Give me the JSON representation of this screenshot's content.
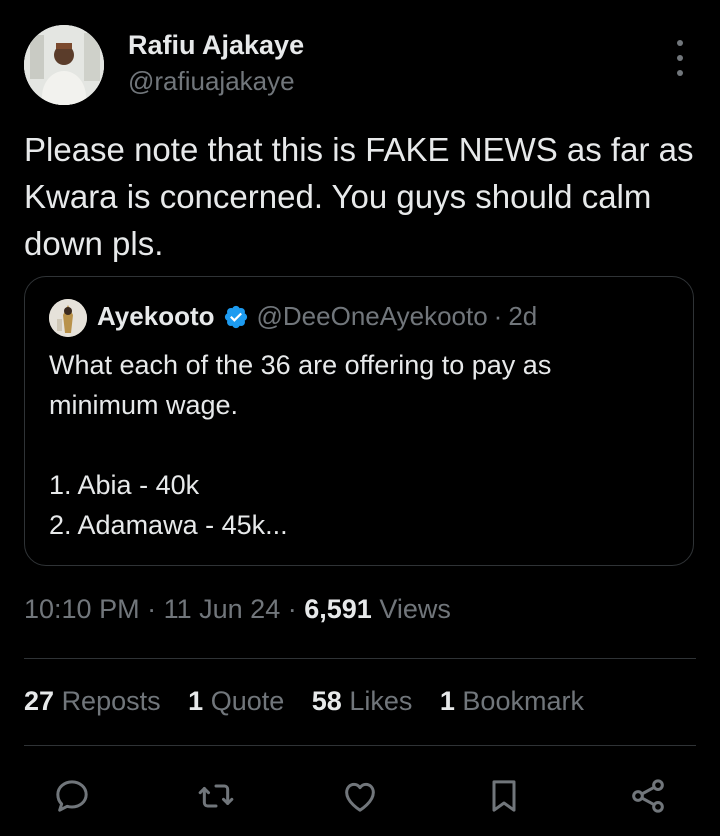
{
  "author": {
    "name": "Rafiu Ajakaye",
    "handle": "@rafiuajakaye",
    "avatar_icon": "profile-photo"
  },
  "tweet": {
    "text": "Please note that this is FAKE NEWS as far as Kwara is concerned. You guys should calm down pls."
  },
  "quoted_tweet": {
    "name": "Ayekooto",
    "verified_icon": "verified-badge-icon",
    "handle": "@DeeOneAyekooto",
    "separator": "·",
    "time": "2d",
    "lines": [
      "What each of the 36 are offering to pay as",
      "minimum wage.",
      "",
      "1. Abia - 40k",
      "2. Adamawa - 45k..."
    ]
  },
  "meta": {
    "time": "10:10 PM",
    "separator": "·",
    "date": "11 Jun 24",
    "views_count": "6,591",
    "views_label": "Views"
  },
  "stats": {
    "reposts_count": "27",
    "reposts_label": "Reposts",
    "quotes_count": "1",
    "quotes_label": "Quote",
    "likes_count": "58",
    "likes_label": "Likes",
    "bookmarks_count": "1",
    "bookmarks_label": "Bookmark"
  },
  "actions": [
    "reply-icon",
    "repost-icon",
    "like-icon",
    "bookmark-icon",
    "share-icon"
  ],
  "colors": {
    "background": "#000000",
    "text_primary": "#e7e9ea",
    "text_secondary": "#71767b",
    "border": "#2f3336",
    "verified_blue": "#1d9bf0"
  }
}
